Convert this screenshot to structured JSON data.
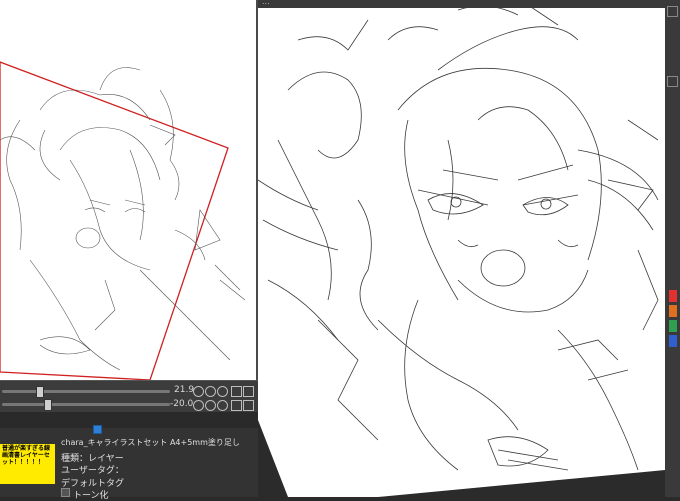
{
  "navigator": {
    "rotation_value": "21.9",
    "zoom_value": "-20.0"
  },
  "main_canvas": {
    "tab_label": "..."
  },
  "layer_panel": {
    "thumbnail_text": "普通が楽すぎる線画清書レイヤーセット！！！！！",
    "thumbnail_subtext": "",
    "layer_name": "chara_キャライラストセット A4+5mm塗り足し",
    "type_row": "種類：レイヤー",
    "user_tag_row": "ユーザータグ：",
    "default_tag_row": "デフォルトタグ",
    "tone_row": "トーン化"
  },
  "colors": {
    "panel_bg": "#333333",
    "window_bg": "#4a4a4a",
    "canvas_bg": "#ffffff",
    "frame_red": "#d02020",
    "thumb_yellow": "#ffeb00",
    "dock_swatches": [
      "#e03030",
      "#e07020",
      "#30a050",
      "#3060d0",
      "#c03030",
      "#20a040"
    ]
  },
  "icons": {
    "rotate_left": "rotate-left-icon",
    "rotate_right": "rotate-right-icon",
    "reset": "reset-icon",
    "flip": "flip-horizontal-icon",
    "checkbox": "checkbox-icon"
  }
}
